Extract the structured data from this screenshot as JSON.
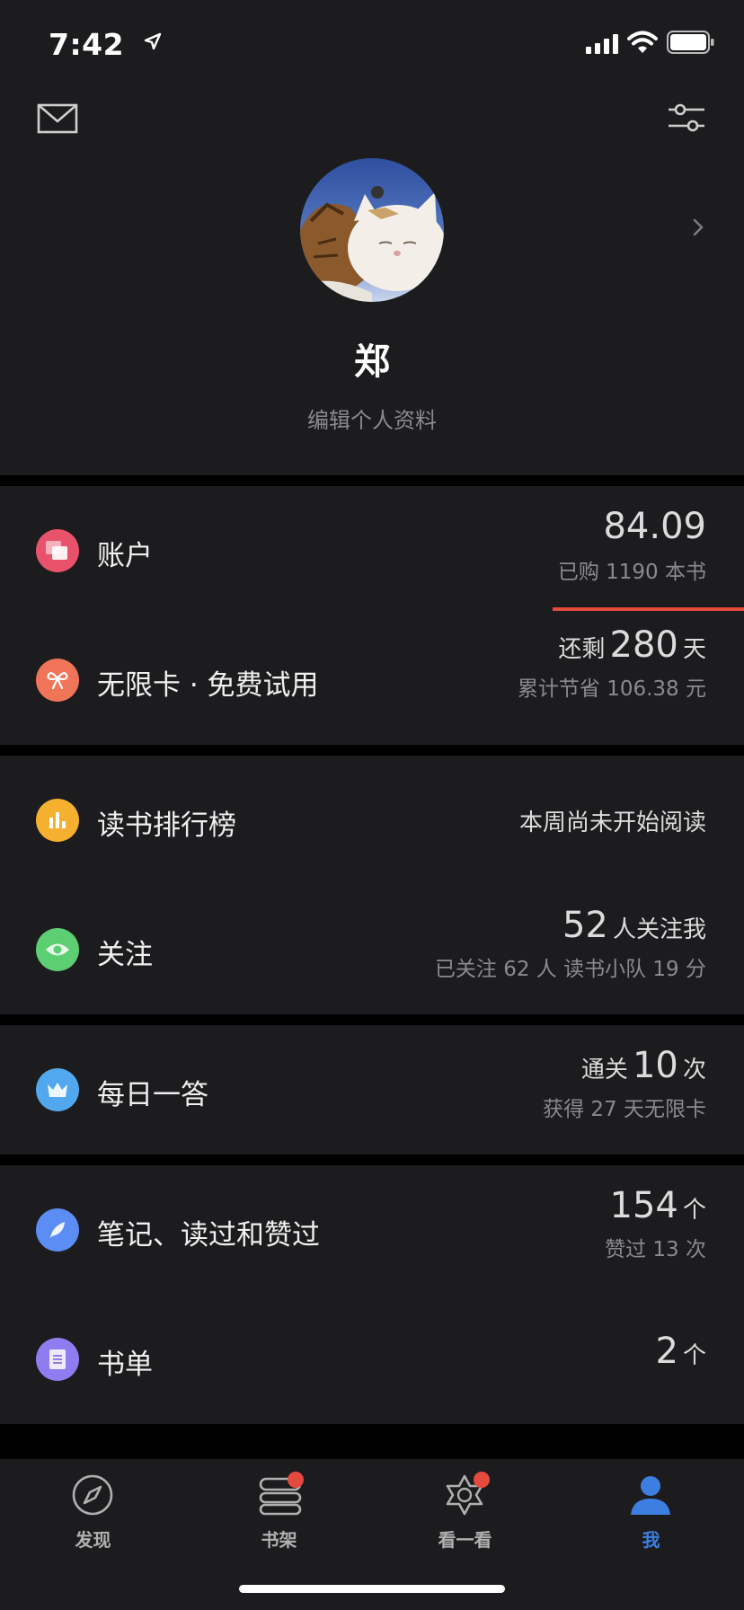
{
  "status_bar": {
    "time": "7:42"
  },
  "profile": {
    "name": "郑",
    "edit_label": "编辑个人资料"
  },
  "rows": {
    "account": {
      "label": "账户",
      "value": "84.09",
      "sub": "已购 1190 本书"
    },
    "unlimited": {
      "label": "无限卡 · 免费试用",
      "prefix": "还剩",
      "value": "280",
      "unit": "天",
      "sub": "累计节省 106.38 元"
    },
    "ranking": {
      "label": "读书排行榜",
      "value": "本周尚未开始阅读"
    },
    "follow": {
      "label": "关注",
      "value": "52",
      "unit": "人关注我",
      "sub": "已关注 62 人  读书小队 19 分"
    },
    "daily": {
      "label": "每日一答",
      "prefix": "通关",
      "value": "10",
      "unit": "次",
      "sub": "获得 27 天无限卡"
    },
    "notes": {
      "label": "笔记、读过和赞过",
      "value": "154",
      "unit": "个",
      "sub": "赞过 13 次"
    },
    "booklist": {
      "label": "书单",
      "value": "2",
      "unit": "个"
    }
  },
  "tabs": [
    {
      "label": "发现",
      "icon": "compass-icon",
      "badge": false
    },
    {
      "label": "书架",
      "icon": "bookshelf-icon",
      "badge": true
    },
    {
      "label": "看一看",
      "icon": "star-hexagon-icon",
      "badge": true
    },
    {
      "label": "我",
      "icon": "person-icon",
      "badge": false,
      "active": true
    }
  ],
  "colors": {
    "active_tab": "#3d7fe0",
    "badge": "#e54a3f",
    "account_icon": "#e8536b",
    "unlimited_icon": "#ef7458",
    "ranking_icon": "#f5b030",
    "follow_icon": "#5ccf72",
    "daily_icon": "#52a8ee",
    "notes_icon": "#5b8df5",
    "booklist_icon": "#8f7cf0"
  }
}
